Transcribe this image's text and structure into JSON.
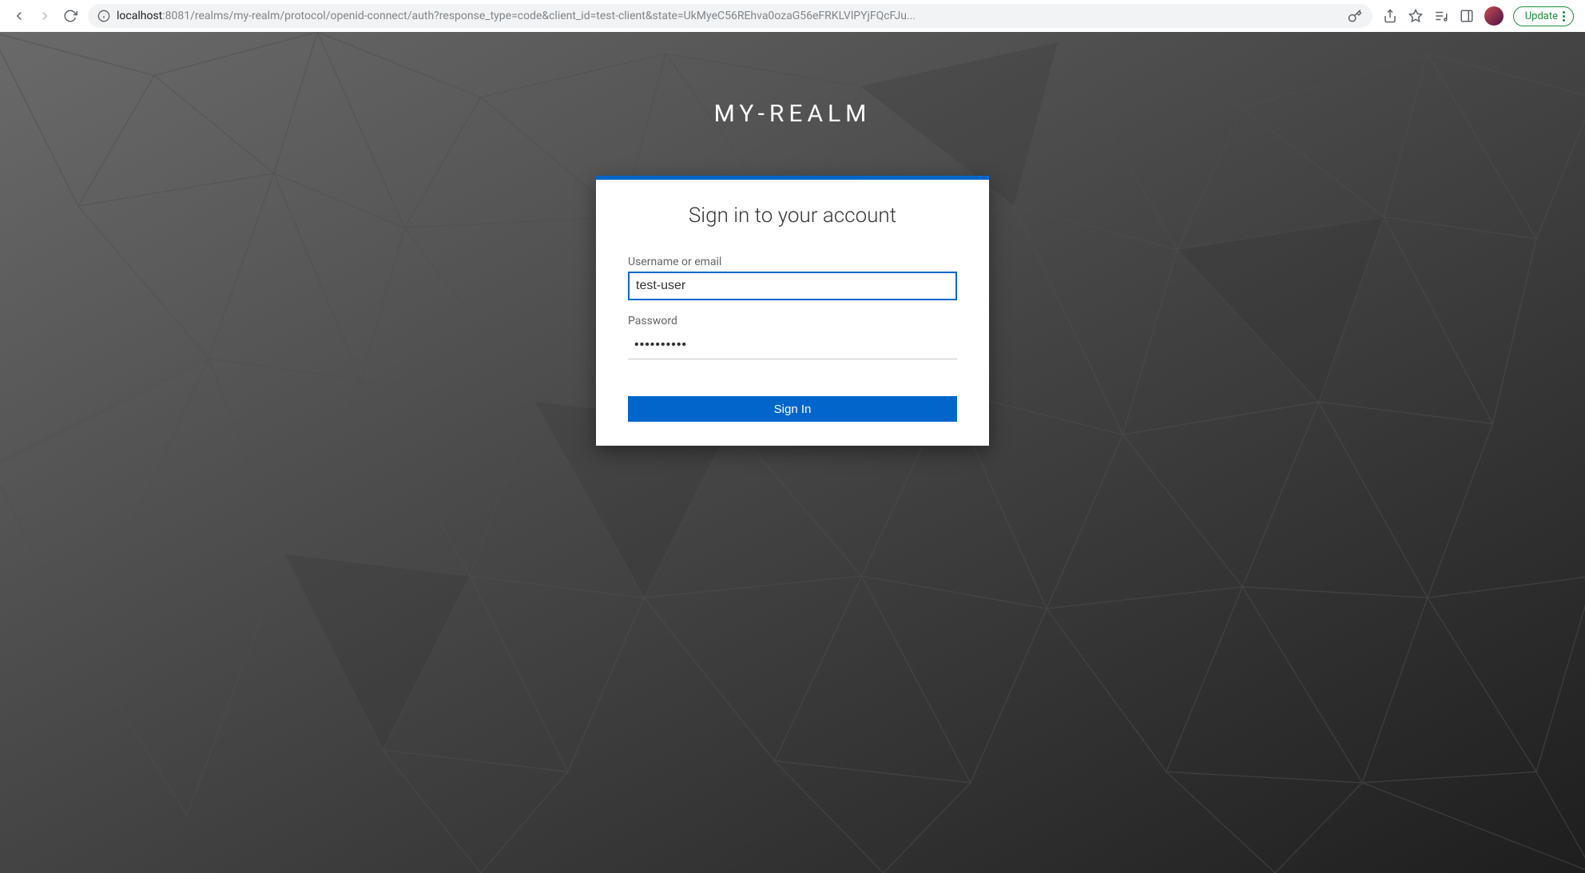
{
  "browser": {
    "url_host": "localhost",
    "url_rest": ":8081/realms/my-realm/protocol/openid-connect/auth?response_type=code&client_id=test-client&state=UkMyeC56REhva0ozaG56eFRKLVlPYjFQcFJu...",
    "update_label": "Update"
  },
  "login": {
    "realm_title": "MY-REALM",
    "card_title": "Sign in to your account",
    "username_label": "Username or email",
    "username_value": "test-user",
    "password_label": "Password",
    "password_value": "••••••••••",
    "signin_label": "Sign In"
  }
}
